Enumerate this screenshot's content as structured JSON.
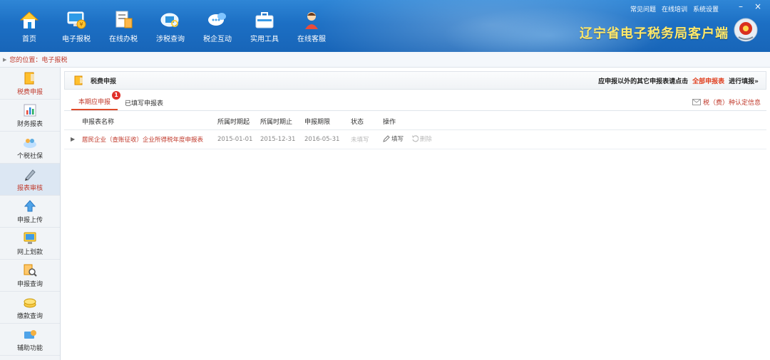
{
  "nav": [
    {
      "label": "首页",
      "icon": "home-icon"
    },
    {
      "label": "电子报税",
      "icon": "tax-report-icon"
    },
    {
      "label": "在线办税",
      "icon": "online-tax-icon"
    },
    {
      "label": "涉税查询",
      "icon": "tax-query-icon"
    },
    {
      "label": "税企互动",
      "icon": "chat-icon"
    },
    {
      "label": "实用工具",
      "icon": "toolbox-icon"
    },
    {
      "label": "在线客服",
      "icon": "customer-service-icon"
    }
  ],
  "toplinks": [
    "常见问题",
    "在线培训",
    "系统设置"
  ],
  "window": {
    "minimize": "–",
    "close": "×"
  },
  "brand_title": "辽宁省电子税务局客户端",
  "breadcrumb": "您的位置：电子报税",
  "sidebar": [
    {
      "label": "税费申报",
      "icon": "declaration-icon"
    },
    {
      "label": "财务报表",
      "icon": "bar-chart-icon"
    },
    {
      "label": "个税社保",
      "icon": "social-security-icon"
    },
    {
      "label": "报表审核",
      "icon": "pen-icon"
    },
    {
      "label": "申报上传",
      "icon": "upload-icon"
    },
    {
      "label": "网上划款",
      "icon": "monitor-icon"
    },
    {
      "label": "申报查询",
      "icon": "doc-search-icon"
    },
    {
      "label": "缴款查询",
      "icon": "coins-icon"
    },
    {
      "label": "辅助功能",
      "icon": "assist-icon"
    }
  ],
  "panel": {
    "title": "税费申报",
    "hint_prefix": "应申报以外的其它申报表请点击",
    "hint_link": "全部申报表",
    "hint_suffix": "进行填报»"
  },
  "tabs": [
    {
      "label": "本期应申报",
      "badge": "1"
    },
    {
      "label": "已填写申报表"
    }
  ],
  "auth_link": "税（费）种认定信息",
  "table": {
    "headers": [
      "申报表名称",
      "所属时期起",
      "所属时期止",
      "申报期限",
      "状态",
      "操作"
    ],
    "rows": [
      {
        "name": "居民企业（查账征收）企业所得税年度申报表",
        "start": "2015-01-01",
        "end": "2015-12-31",
        "deadline": "2016-05-31",
        "status": "未填写",
        "fill": "填写",
        "delete": "删除"
      }
    ]
  },
  "colors": {
    "accent": "#c0392b",
    "banner": "#1c6fc4",
    "brand": "#ffe86a"
  }
}
